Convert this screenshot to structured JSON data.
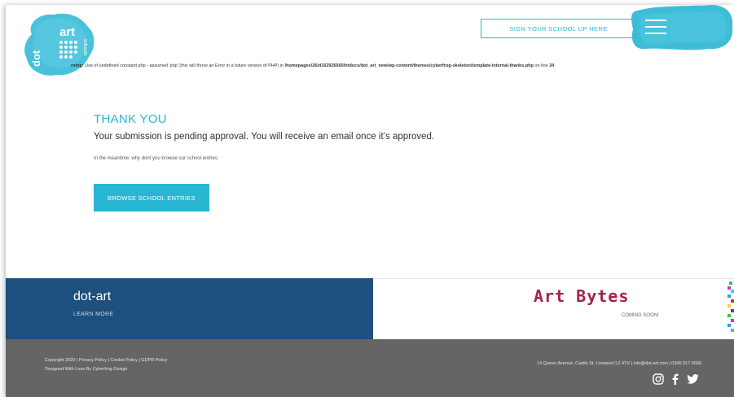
{
  "header": {
    "logo_lines": [
      "art",
      "dot",
      "schools"
    ],
    "warning": {
      "label": "rning:",
      "text": " Use of undefined constant php - assumed 'php' (this will throw an Error in a future version of PHP) in ",
      "path": "/homepages/26/d162926560/htdocs/dot_art_new/wp-content/themes/cyberfrog-skeleton/template-internal-thanks.php",
      "line_text": " on line ",
      "line_no": "34"
    },
    "signup_label": "SIGN YOUR SCHOOL UP HERE"
  },
  "main": {
    "title": "THANK YOU",
    "pending": "Your submission is pending approval. You will receive an email once it’s approved.",
    "meantime": "In the meantime, why dont you browse our school entries.",
    "browse_label": "BROWSE SCHOOL ENTRIES"
  },
  "promo": {
    "left_title": "dot-art",
    "left_link": "LEARN MORE",
    "right_title": "Art Bytes",
    "right_sub": "COMING SOON!"
  },
  "footer": {
    "copyright": "Copyright 2020 | Privacy Policy | Cookie Policy | GDPR Policy",
    "designed": "Designed With Love By Cyberfrog Design",
    "address": "14 Queen Avenue, Castle St, Liverpool L2 4TX | info@dot-art.com | 0345 017 6660",
    "socials": [
      "instagram-icon",
      "facebook-icon",
      "twitter-icon"
    ]
  },
  "colors": {
    "accent": "#29b6d3",
    "navy": "#1d4f7f",
    "artbytes": "#a8204e",
    "footer": "#656565"
  }
}
